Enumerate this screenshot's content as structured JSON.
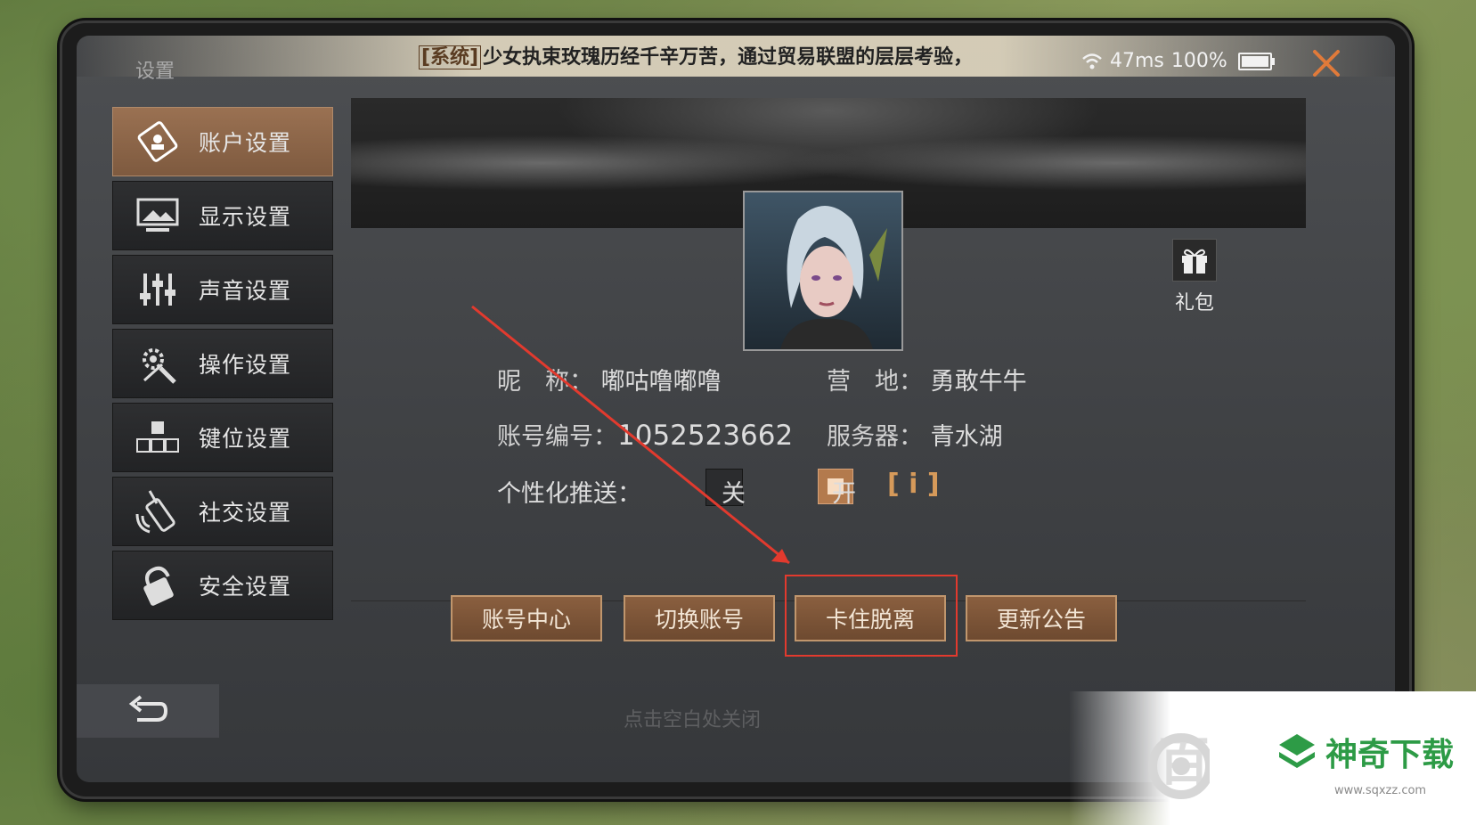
{
  "header": {
    "title": "设置",
    "ticker_tag": "[系统]",
    "ticker_text": "少女执束玫瑰历经千辛万苦，通过贸易联盟的层层考验，",
    "ping": "47ms",
    "battery": "100%"
  },
  "sidebar": {
    "items": [
      {
        "label": "账户设置",
        "icon": "account-card-icon",
        "active": true
      },
      {
        "label": "显示设置",
        "icon": "display-icon",
        "active": false
      },
      {
        "label": "声音设置",
        "icon": "sliders-icon",
        "active": false
      },
      {
        "label": "操作设置",
        "icon": "gear-icon",
        "active": false
      },
      {
        "label": "键位设置",
        "icon": "keys-icon",
        "active": false
      },
      {
        "label": "社交设置",
        "icon": "walkie-talkie-icon",
        "active": false
      },
      {
        "label": "安全设置",
        "icon": "lock-icon",
        "active": false
      }
    ]
  },
  "gift": {
    "label": "礼包"
  },
  "profile": {
    "nickname_label": "昵　称：",
    "nickname": "嘟咕噜嘟噜",
    "camp_label": "营　地：",
    "camp": "勇敢牛牛",
    "account_label": "账号编号：",
    "account_id": "1052523662",
    "server_label": "服务器：",
    "server": "青水湖",
    "push_label": "个性化推送：",
    "push_off": "关",
    "push_on": "开",
    "push_state": "on",
    "info_icon": "[ i ]"
  },
  "actions": {
    "account_center": "账号中心",
    "switch_account": "切换账号",
    "unstuck": "卡住脱离",
    "update_notice": "更新公告"
  },
  "footer": {
    "hint": "点击空白处关闭"
  },
  "watermark": {
    "brand": "神奇下载",
    "url": "www.sqxzz.com",
    "bai": "百"
  },
  "colors": {
    "accent": "#8a5f3f",
    "highlight": "#e23a2e",
    "close": "#e07a3a"
  }
}
